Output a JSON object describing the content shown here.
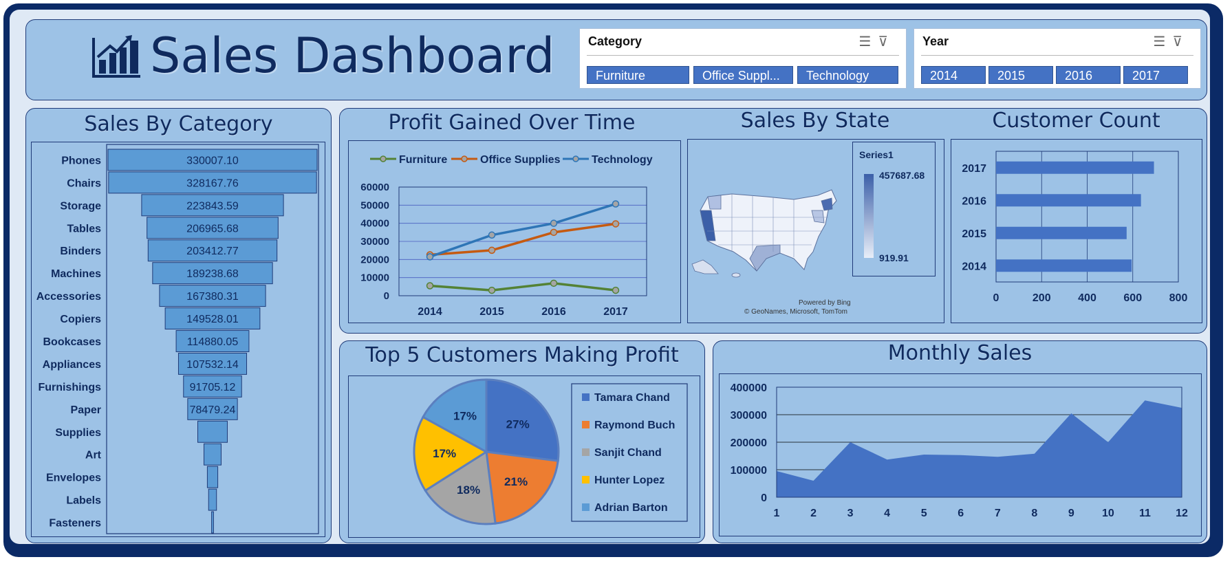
{
  "header": {
    "title": "Sales Dashboard"
  },
  "slicers": {
    "category": {
      "title": "Category",
      "items": [
        "Furniture",
        "Office Suppl...",
        "Technology"
      ]
    },
    "year": {
      "title": "Year",
      "items": [
        "2014",
        "2015",
        "2016",
        "2017"
      ]
    }
  },
  "panels": {
    "sales_by_category": "Sales By Category",
    "profit_over_time": "Profit Gained Over Time",
    "sales_by_state": "Sales By State",
    "customer_count": "Customer Count",
    "top5": "Top 5 Customers Making Profit",
    "monthly": "Monthly Sales"
  },
  "map": {
    "legend_title": "Series1",
    "max_label": "457687.68",
    "min_label": "919.91",
    "credit1": "Powered by Bing",
    "credit2": "© GeoNames, Microsoft, TomTom"
  },
  "chart_data": [
    {
      "id": "sales-by-category",
      "type": "bar",
      "title": "Sales By Category",
      "orientation": "funnel",
      "categories": [
        "Phones",
        "Chairs",
        "Storage",
        "Tables",
        "Binders",
        "Machines",
        "Accessories",
        "Copiers",
        "Bookcases",
        "Appliances",
        "Furnishings",
        "Paper",
        "Supplies",
        "Art",
        "Envelopes",
        "Labels",
        "Fasteners"
      ],
      "values": [
        330007.1,
        328167.76,
        223843.59,
        206965.68,
        203412.77,
        189238.68,
        167380.31,
        149528.01,
        114880.05,
        107532.14,
        91705.12,
        78479.24,
        46673.54,
        27118.79,
        16476.4,
        12486.31,
        3024.28
      ],
      "labels": [
        "330007.10",
        "328167.76",
        "223843.59",
        "206965.68",
        "203412.77",
        "189238.68",
        "167380.31",
        "149528.01",
        "114880.05",
        "107532.14",
        "91705.12",
        "78479.24",
        "",
        "",
        "",
        "",
        ""
      ],
      "color": "#5b9bd5"
    },
    {
      "id": "profit-over-time",
      "type": "line",
      "title": "Profit Gained Over Time",
      "x": [
        "2014",
        "2015",
        "2016",
        "2017"
      ],
      "series": [
        {
          "name": "Furniture",
          "values": [
            5500,
            3000,
            6900,
            3000
          ],
          "color": "#548235"
        },
        {
          "name": "Office Supplies",
          "values": [
            22600,
            25100,
            35000,
            39700
          ],
          "color": "#c55a11"
        },
        {
          "name": "Technology",
          "values": [
            21500,
            33500,
            40000,
            50700
          ],
          "color": "#2e75b6"
        }
      ],
      "ylim": [
        0,
        60000
      ],
      "yticks": [
        0,
        10000,
        20000,
        30000,
        40000,
        50000,
        60000
      ],
      "legend": "top"
    },
    {
      "id": "customer-count",
      "type": "bar",
      "orientation": "horizontal",
      "title": "Customer Count",
      "categories": [
        "2017",
        "2016",
        "2015",
        "2014"
      ],
      "values": [
        693,
        636,
        573,
        595
      ],
      "xlim": [
        0,
        800
      ],
      "xticks": [
        0,
        200,
        400,
        600,
        800
      ],
      "color": "#4472c4"
    },
    {
      "id": "top5-customers",
      "type": "pie",
      "title": "Top 5 Customers Making Profit",
      "labels": [
        "Tamara Chand",
        "Raymond Buch",
        "Sanjit Chand",
        "Hunter Lopez",
        "Adrian Barton"
      ],
      "values": [
        27,
        21,
        18,
        17,
        17
      ],
      "value_labels": [
        "27%",
        "21%",
        "18%",
        "17%",
        "17%"
      ],
      "colors": [
        "#4472c4",
        "#ed7d31",
        "#a5a5a5",
        "#ffc000",
        "#5b9bd5"
      ],
      "legend": "right"
    },
    {
      "id": "monthly-sales",
      "type": "area",
      "title": "Monthly Sales",
      "x": [
        1,
        2,
        3,
        4,
        5,
        6,
        7,
        8,
        9,
        10,
        11,
        12
      ],
      "values": [
        95000,
        60000,
        200000,
        137000,
        155000,
        153000,
        147000,
        158000,
        305000,
        200000,
        352000,
        325000
      ],
      "ylim": [
        0,
        400000
      ],
      "yticks": [
        0,
        100000,
        200000,
        300000,
        400000
      ],
      "color": "#4472c4"
    }
  ]
}
